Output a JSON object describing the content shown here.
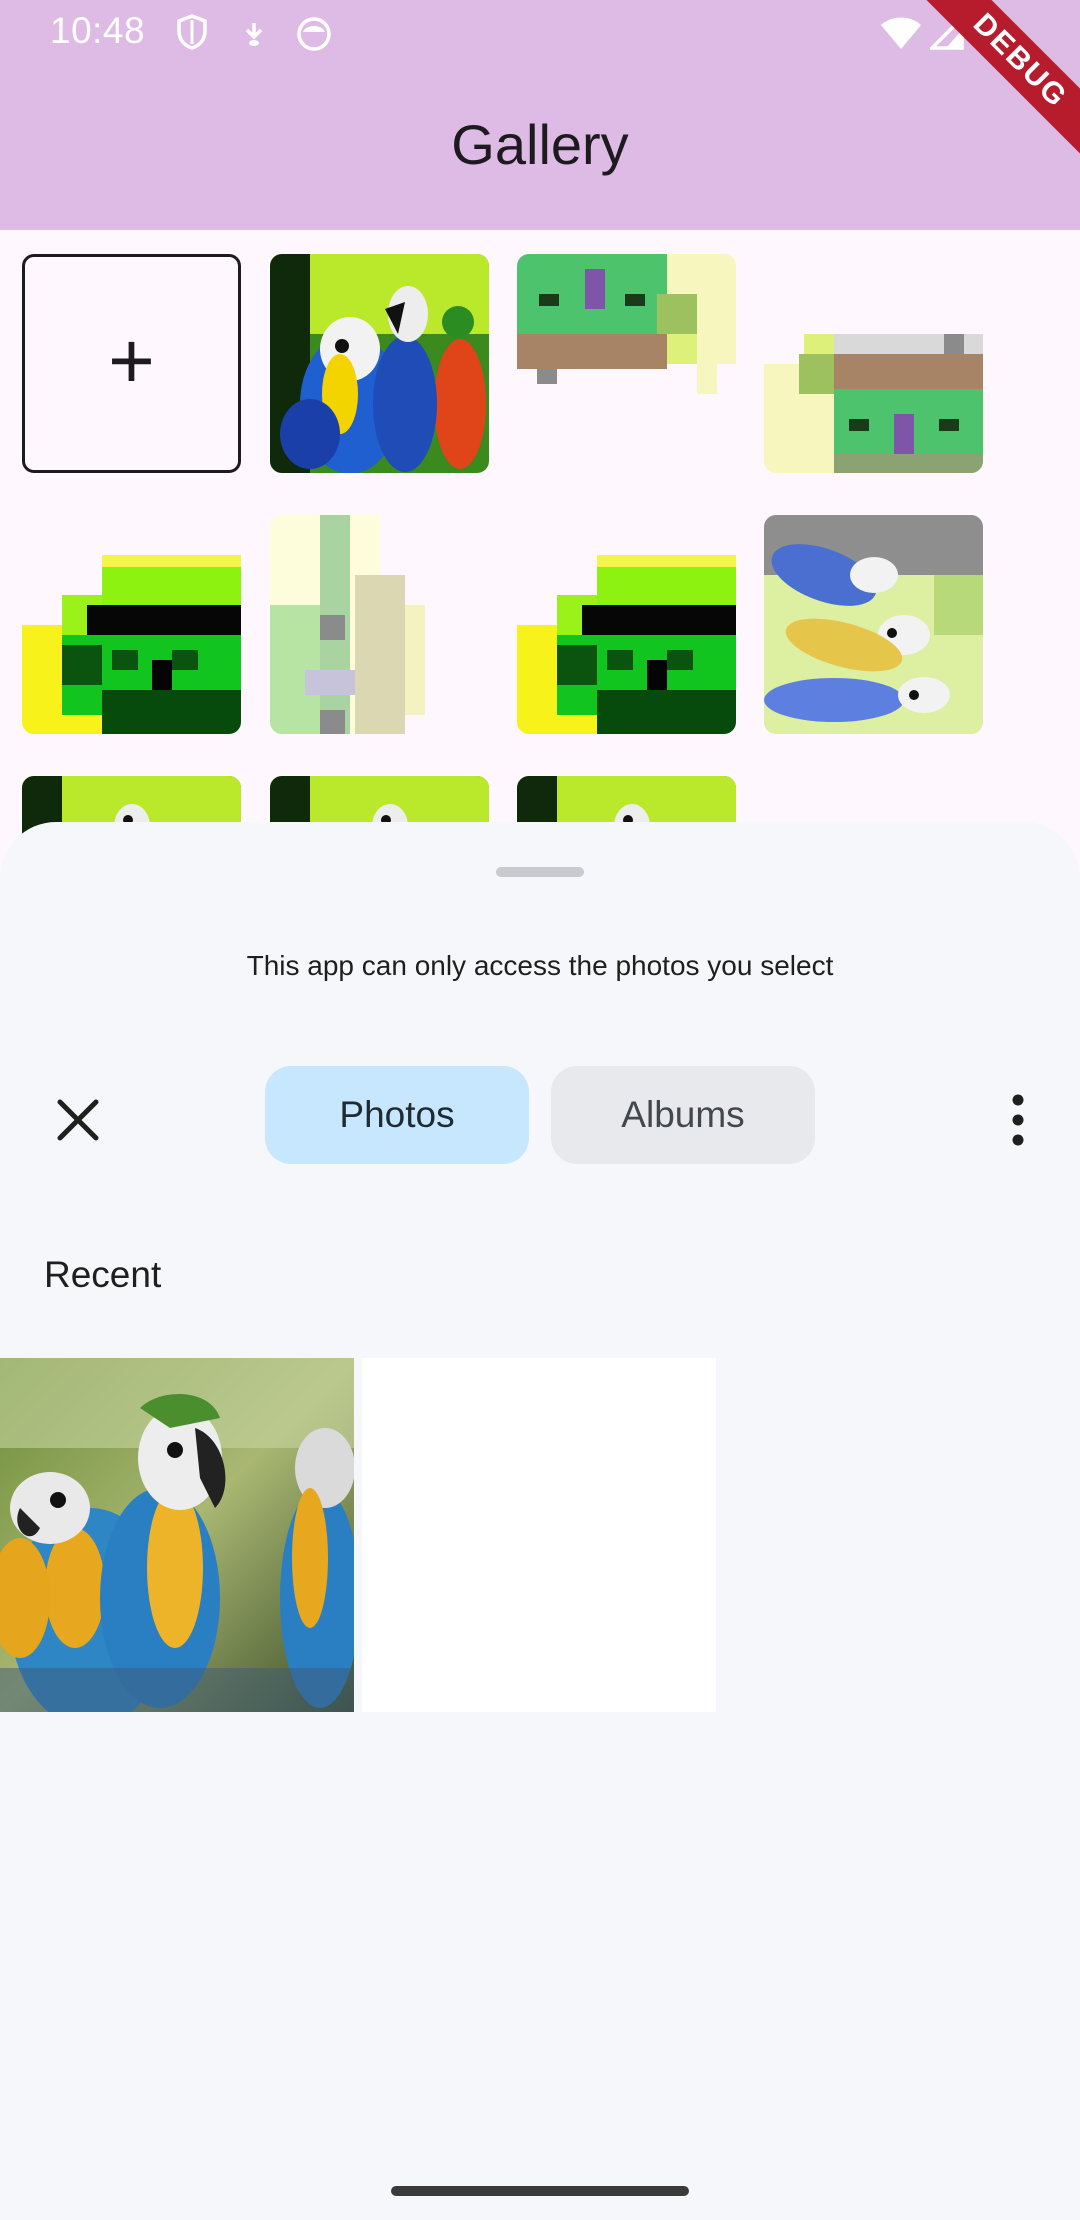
{
  "status_bar": {
    "time": "10:48"
  },
  "app_bar": {
    "title": "Gallery",
    "debug_label": "DEBUG"
  },
  "gallery": {
    "add_label": "+",
    "images": [
      "macaw-vivid",
      "pixel-house-green",
      "pixel-house-flipped",
      "pixel-house-yellow",
      "pixel-tower-pale",
      "pixel-house-yellow",
      "macaw-pastel",
      "macaw-vivid",
      "macaw-vivid",
      "macaw-vivid"
    ]
  },
  "picker": {
    "notice": "This app can only access the photos you select",
    "tabs": {
      "photos": "Photos",
      "albums": "Albums"
    },
    "section_title": "Recent"
  },
  "colors": {
    "app_bar": "#DEBBE4",
    "sheet_bg": "#F6F7FB",
    "tab_selected": "#C6E7FD",
    "tab_unselected": "#E8E9EC",
    "debug_banner": "#B71C2C"
  }
}
